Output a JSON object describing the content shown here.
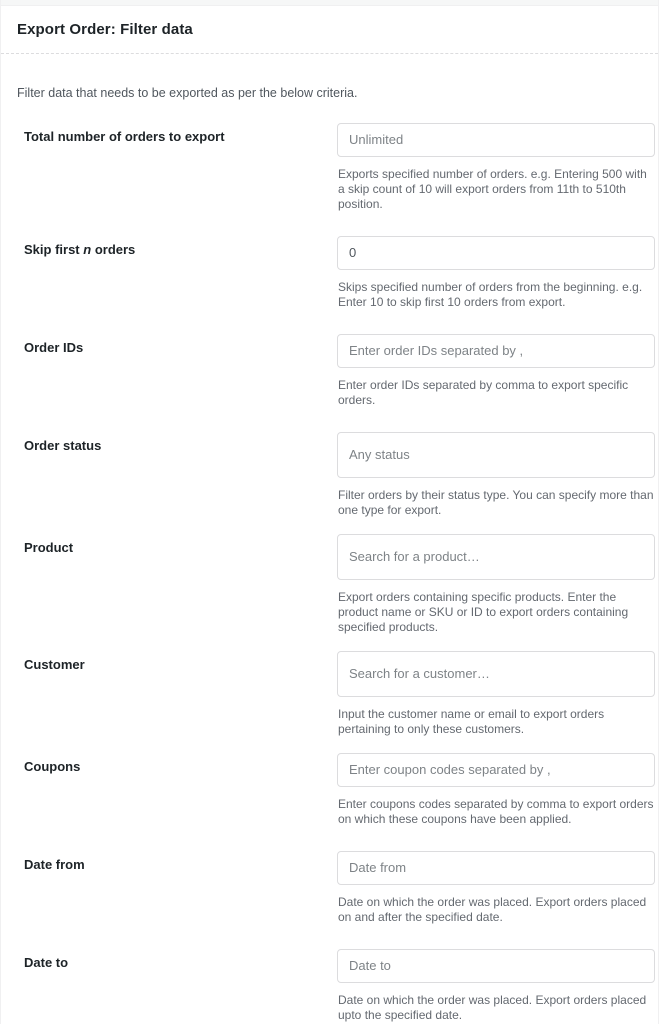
{
  "header": {
    "title": "Export Order: Filter data"
  },
  "intro": {
    "text": "Filter data that needs to be exported as per the below criteria."
  },
  "colors": {
    "label": "#1d2327",
    "description": "#646970",
    "border": "#dcdcde",
    "placeholder": "#7e8387",
    "background": "#ffffff"
  },
  "fields": [
    {
      "label_prefix": "Total number of orders to export",
      "label_em": "",
      "label_suffix": "",
      "control": "text-input",
      "value": "Unlimited",
      "is_placeholder": true,
      "description": "Exports specified number of orders. e.g. Entering 500 with a skip count of 10 will export orders from 11th to 510th position."
    },
    {
      "label_prefix": "Skip first ",
      "label_em": "n",
      "label_suffix": " orders",
      "control": "text-input",
      "value": "0",
      "is_placeholder": false,
      "description": "Skips specified number of orders from the beginning. e.g. Enter 10 to skip first 10 orders from export."
    },
    {
      "label_prefix": "Order IDs",
      "label_em": "",
      "label_suffix": "",
      "control": "text-input",
      "value": "Enter order IDs separated by ,",
      "is_placeholder": true,
      "description": "Enter order IDs separated by comma to export specific orders."
    },
    {
      "label_prefix": "Order status",
      "label_em": "",
      "label_suffix": "",
      "control": "multiselect",
      "value": "Any status",
      "is_placeholder": true,
      "description": "Filter orders by their status type. You can specify more than one type for export."
    },
    {
      "label_prefix": "Product",
      "label_em": "",
      "label_suffix": "",
      "control": "multiselect",
      "value": "Search for a product…",
      "is_placeholder": true,
      "description": "Export orders containing specific products. Enter the product name or SKU or ID to export orders containing specified products."
    },
    {
      "label_prefix": "Customer",
      "label_em": "",
      "label_suffix": "",
      "control": "multiselect",
      "value": "Search for a customer…",
      "is_placeholder": true,
      "description": "Input the customer name or email to export orders pertaining to only these customers."
    },
    {
      "label_prefix": "Coupons",
      "label_em": "",
      "label_suffix": "",
      "control": "text-input",
      "value": "Enter coupon codes separated by ,",
      "is_placeholder": true,
      "description": "Enter coupons codes separated by comma to export orders on which these coupons have been applied."
    },
    {
      "label_prefix": "Date from",
      "label_em": "",
      "label_suffix": "",
      "control": "date-input",
      "value": "Date from",
      "is_placeholder": true,
      "description": "Date on which the order was placed. Export orders placed on and after the specified date."
    },
    {
      "label_prefix": "Date to",
      "label_em": "",
      "label_suffix": "",
      "control": "date-input",
      "value": "Date to",
      "is_placeholder": true,
      "description": "Date on which the order was placed. Export orders placed upto the specified date."
    }
  ]
}
